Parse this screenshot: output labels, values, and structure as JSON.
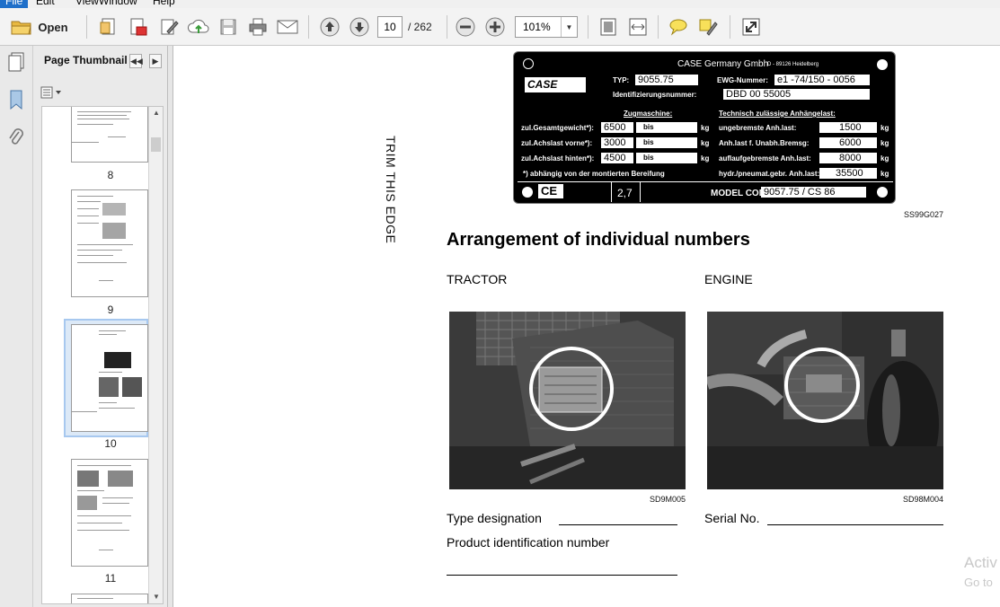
{
  "menu": [
    "File",
    "Edit",
    "View",
    "Window",
    "Help"
  ],
  "toolbar": {
    "open_label": "Open",
    "current_page": "10",
    "page_total": "/ 262",
    "zoom": "101%"
  },
  "thumbnails": {
    "title": "Page Thumbnails",
    "pages": [
      "8",
      "9",
      "10",
      "11"
    ],
    "selected": "10"
  },
  "document": {
    "trim_text": "TRIM THIS EDGE",
    "plate": {
      "company": "CASE Germany Gmbh",
      "address": "D - 89126 Heidelberg",
      "brand": "CASE",
      "typ_label": "TYP:",
      "typ_value": "9055.75",
      "ewg_label": "EWG-Nummer:",
      "ewg_value": "e1 -74/150 - 0056",
      "ident_label": "Identifizierungsnummer:",
      "ident_value": "DBD 00 55005",
      "zug_header": "Zugmaschine:",
      "tech_header": "Technisch zulässige Anhängelast:",
      "rows_left": [
        {
          "label": "zul.Gesamtgewicht*):",
          "value": "6500",
          "bis": "bis",
          "unit": "kg"
        },
        {
          "label": "zul.Achslast vorne*):",
          "value": "3000",
          "bis": "bis",
          "unit": "kg"
        },
        {
          "label": "zul.Achslast hinten*):",
          "value": "4500",
          "bis": "bis",
          "unit": "kg"
        }
      ],
      "rows_right": [
        {
          "label": "ungebremste Anh.last:",
          "value": "1500",
          "unit": "kg"
        },
        {
          "label": "Anh.last f. Unabh.Bremsg:",
          "value": "6000",
          "unit": "kg"
        },
        {
          "label": "auflaufgebremste Anh.last:",
          "value": "8000",
          "unit": "kg"
        },
        {
          "label": "hydr./pneumat.gebr. Anh.last:",
          "value": "35500",
          "unit": "kg"
        }
      ],
      "footnote": "*) abhängig von der montierten Bereifung",
      "ce": "CE",
      "noise": "2,7",
      "model_label": "MODEL CODE",
      "model_value": "9057.75 / CS 86"
    },
    "plate_caption": "SS99G027",
    "heading": "Arrangement of individual numbers",
    "tractor_label": "TRACTOR",
    "engine_label": "ENGINE",
    "photo1_caption": "SD9M005",
    "photo2_caption": "SD98M004",
    "type_designation": "Type designation",
    "serial_no": "Serial No.",
    "product_id": "Product identification number"
  },
  "watermark": {
    "line1": "Activ",
    "line2": "Go to"
  }
}
